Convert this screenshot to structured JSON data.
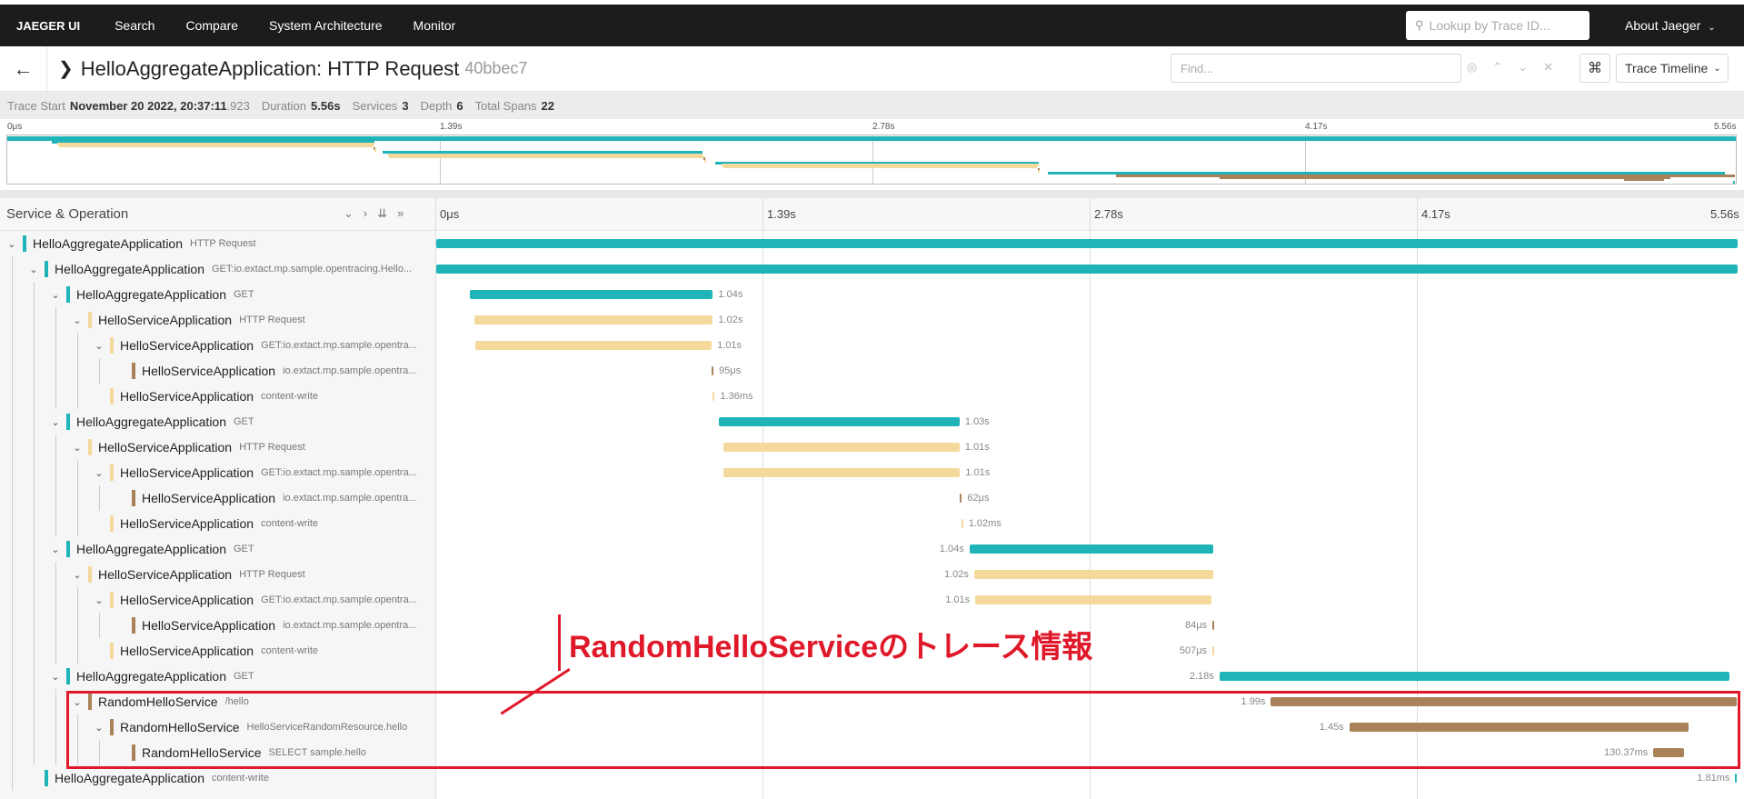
{
  "nav": {
    "brand": "JAEGER UI",
    "items": [
      "Search",
      "Compare",
      "System Architecture",
      "Monitor"
    ],
    "lookup_placeholder": "Lookup by Trace ID...",
    "about": "About Jaeger"
  },
  "header": {
    "title": "HelloAggregateApplication: HTTP Request",
    "trace_id": "40bbec7",
    "find_placeholder": "Find...",
    "view_mode": "Trace Timeline"
  },
  "meta": {
    "trace_start_label": "Trace Start",
    "trace_start_date": "November 20 2022, 20:37:11",
    "trace_start_ms": ".923",
    "duration_label": "Duration",
    "duration": "5.56s",
    "services_label": "Services",
    "services": "3",
    "depth_label": "Depth",
    "depth": "6",
    "spans_label": "Total Spans",
    "spans": "22"
  },
  "ticks": [
    "0μs",
    "1.39s",
    "2.78s",
    "4.17s",
    "5.56s"
  ],
  "table": {
    "service_operation_label": "Service & Operation"
  },
  "colors": {
    "aggregate": "#1fb5b8",
    "service": "#f5d99c",
    "random": "#a9825a",
    "annotation": "#e0192a"
  },
  "spans": [
    {
      "depth": 0,
      "toggle": "expanded",
      "service": "HelloAggregateApplication",
      "operation": "HTTP Request",
      "color": "aggregate",
      "start": 0,
      "dur": 5.56,
      "label": ""
    },
    {
      "depth": 1,
      "toggle": "expanded",
      "service": "HelloAggregateApplication",
      "operation": "GET:io.extact.mp.sample.opentracing.Hello...",
      "color": "aggregate",
      "start": 0,
      "dur": 5.56,
      "label": ""
    },
    {
      "depth": 2,
      "toggle": "expanded",
      "service": "HelloAggregateApplication",
      "operation": "GET",
      "color": "aggregate",
      "start": 0.142,
      "dur": 1.04,
      "label": "1.04s"
    },
    {
      "depth": 3,
      "toggle": "expanded",
      "service": "HelloServiceApplication",
      "operation": "HTTP Request",
      "color": "service",
      "start": 0.162,
      "dur": 1.02,
      "label": "1.02s"
    },
    {
      "depth": 4,
      "toggle": "expanded",
      "service": "HelloServiceApplication",
      "operation": "GET:io.extact.mp.sample.opentra...",
      "color": "service",
      "start": 0.167,
      "dur": 1.01,
      "label": "1.01s"
    },
    {
      "depth": 5,
      "toggle": "none",
      "service": "HelloServiceApplication",
      "operation": "io.extact.mp.sample.opentra...",
      "color": "random",
      "start": 1.177,
      "dur": 0.0001,
      "label": "95μs"
    },
    {
      "depth": 4,
      "toggle": "none",
      "service": "HelloServiceApplication",
      "operation": "content-write",
      "color": "service",
      "start": 1.182,
      "dur": 0.0014,
      "label": "1.36ms"
    },
    {
      "depth": 2,
      "toggle": "expanded",
      "service": "HelloAggregateApplication",
      "operation": "GET",
      "color": "aggregate",
      "start": 1.206,
      "dur": 1.03,
      "label": "1.03s"
    },
    {
      "depth": 3,
      "toggle": "expanded",
      "service": "HelloServiceApplication",
      "operation": "HTTP Request",
      "color": "service",
      "start": 1.226,
      "dur": 1.01,
      "label": "1.01s"
    },
    {
      "depth": 4,
      "toggle": "expanded",
      "service": "HelloServiceApplication",
      "operation": "GET:io.extact.mp.sample.opentra...",
      "color": "service",
      "start": 1.228,
      "dur": 1.01,
      "label": "1.01s"
    },
    {
      "depth": 5,
      "toggle": "none",
      "service": "HelloServiceApplication",
      "operation": "io.extact.mp.sample.opentra...",
      "color": "random",
      "start": 2.238,
      "dur": 0.0001,
      "label": "62μs"
    },
    {
      "depth": 4,
      "toggle": "none",
      "service": "HelloServiceApplication",
      "operation": "content-write",
      "color": "service",
      "start": 2.243,
      "dur": 0.001,
      "label": "1.02ms"
    },
    {
      "depth": 2,
      "toggle": "expanded",
      "service": "HelloAggregateApplication",
      "operation": "GET",
      "color": "aggregate",
      "start": 2.278,
      "dur": 1.04,
      "label": "1.04s",
      "label_left": true
    },
    {
      "depth": 3,
      "toggle": "expanded",
      "service": "HelloServiceApplication",
      "operation": "HTTP Request",
      "color": "service",
      "start": 2.298,
      "dur": 1.02,
      "label": "1.02s",
      "label_left": true
    },
    {
      "depth": 4,
      "toggle": "expanded",
      "service": "HelloServiceApplication",
      "operation": "GET:io.extact.mp.sample.opentra...",
      "color": "service",
      "start": 2.303,
      "dur": 1.01,
      "label": "1.01s",
      "label_left": true
    },
    {
      "depth": 5,
      "toggle": "none",
      "service": "HelloServiceApplication",
      "operation": "io.extact.mp.sample.opentra...",
      "color": "random",
      "start": 3.316,
      "dur": 0.0001,
      "label": "84μs",
      "label_left": true
    },
    {
      "depth": 4,
      "toggle": "none",
      "service": "HelloServiceApplication",
      "operation": "content-write",
      "color": "service",
      "start": 3.316,
      "dur": 0.0005,
      "label": "507μs",
      "label_left": true
    },
    {
      "depth": 2,
      "toggle": "expanded",
      "service": "HelloAggregateApplication",
      "operation": "GET",
      "color": "aggregate",
      "start": 3.346,
      "dur": 2.18,
      "label": "2.18s",
      "label_left": true
    },
    {
      "depth": 3,
      "toggle": "expanded",
      "service": "RandomHelloService",
      "operation": "/hello",
      "color": "random",
      "start": 3.566,
      "dur": 1.99,
      "label": "1.99s",
      "label_left": true
    },
    {
      "depth": 4,
      "toggle": "expanded",
      "service": "RandomHelloService",
      "operation": "HelloServiceRandomResource.hello",
      "color": "random",
      "start": 3.901,
      "dur": 1.45,
      "label": "1.45s",
      "label_left": true
    },
    {
      "depth": 5,
      "toggle": "none",
      "service": "RandomHelloService",
      "operation": "SELECT sample.hello",
      "color": "random",
      "start": 5.2,
      "dur": 0.13037,
      "label": "130.37ms",
      "label_left": true
    },
    {
      "depth": 1,
      "toggle": "none",
      "service": "HelloAggregateApplication",
      "operation": "content-write",
      "color": "aggregate",
      "start": 5.55,
      "dur": 0.0018,
      "label": "1.81ms",
      "label_left": true
    }
  ],
  "annotation": {
    "text": "RandomHelloServiceのトレース情報"
  }
}
